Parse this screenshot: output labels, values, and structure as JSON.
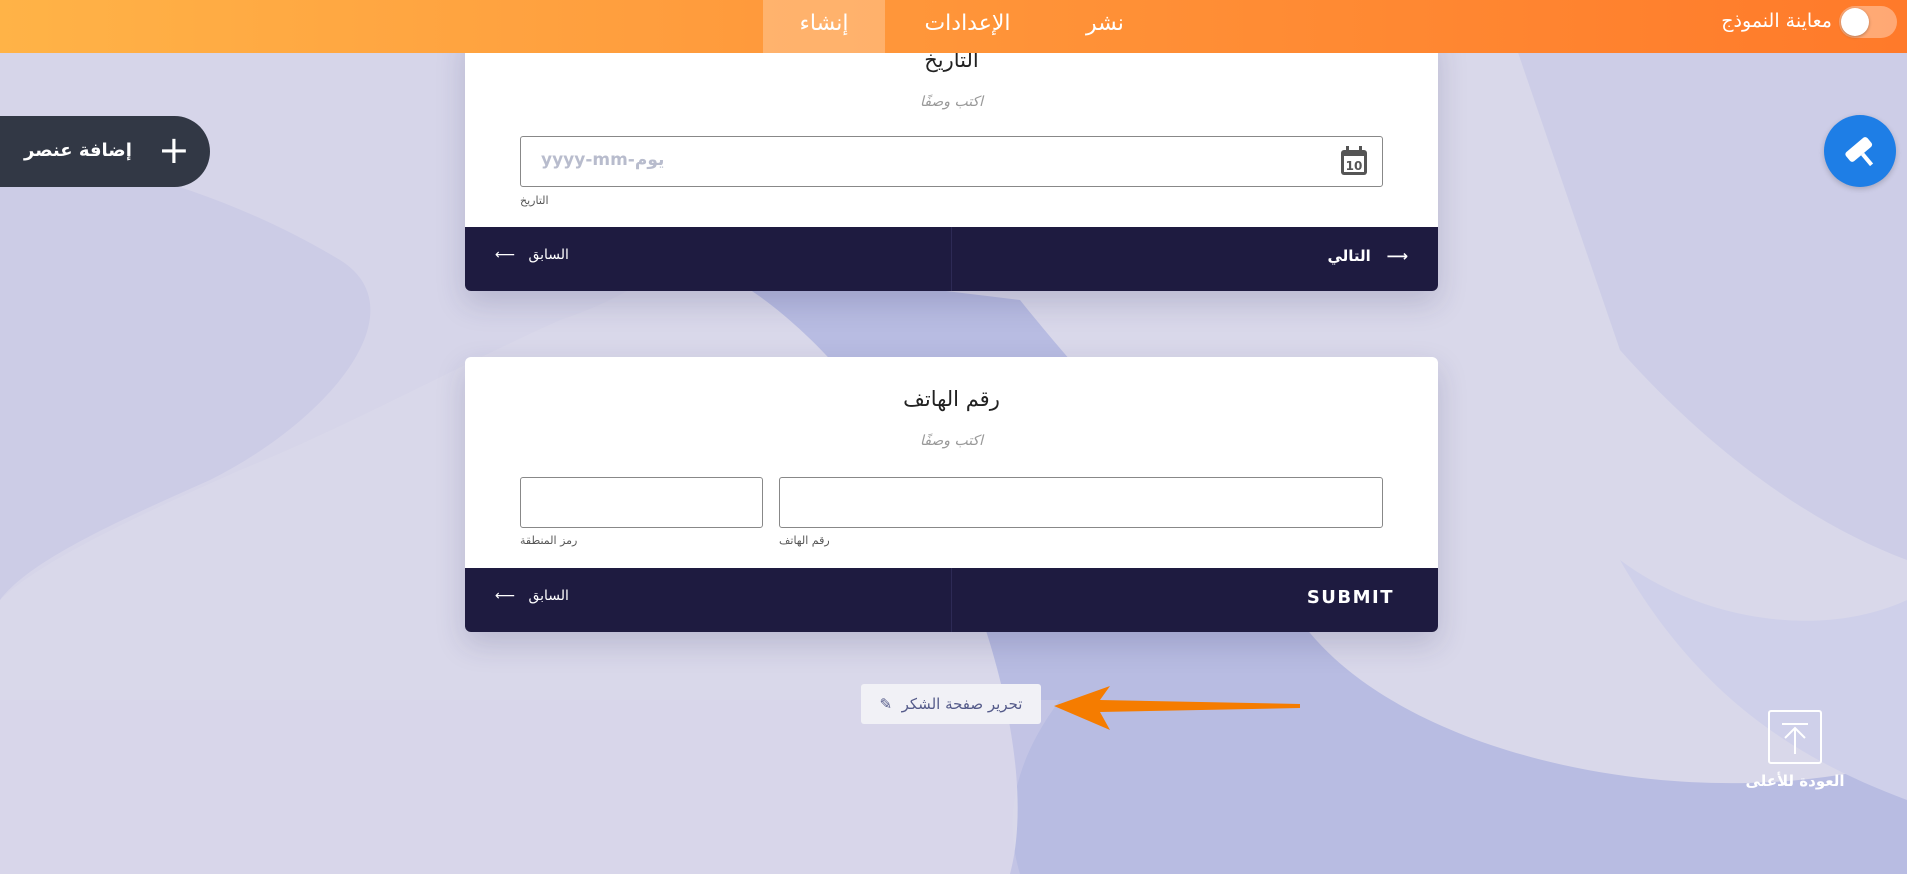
{
  "topbar": {
    "tabs": [
      "إنشاء",
      "الإعدادات",
      "نشر"
    ],
    "preview_label": "معاينة النموذج"
  },
  "add_element": {
    "label": "إضافة عنصر"
  },
  "date_question": {
    "title": "التاريخ",
    "description": "اكتب وصفًا",
    "placeholder": "yyyy-mm-يوم",
    "sublabel": "التاريخ",
    "prev_label": "السابق",
    "next_label": "التالي"
  },
  "phone_question": {
    "title": "رقم الهاتف",
    "description": "اكتب وصفًا",
    "area_code_label": "رمز المنطقة",
    "phone_label": "رقم الهاتف",
    "prev_label": "السابق",
    "submit_label": "SUBMIT"
  },
  "thank_you_button": {
    "label": "تحرير صفحة الشكر"
  },
  "back_to_top": {
    "label": "العودة للأعلى"
  },
  "colors": {
    "topbar_start": "#ffb347",
    "topbar_end": "#ff7a2a",
    "form_footer": "#1e1b40",
    "accent_blue": "#1e7ee6",
    "arrow": "#f57c00"
  }
}
